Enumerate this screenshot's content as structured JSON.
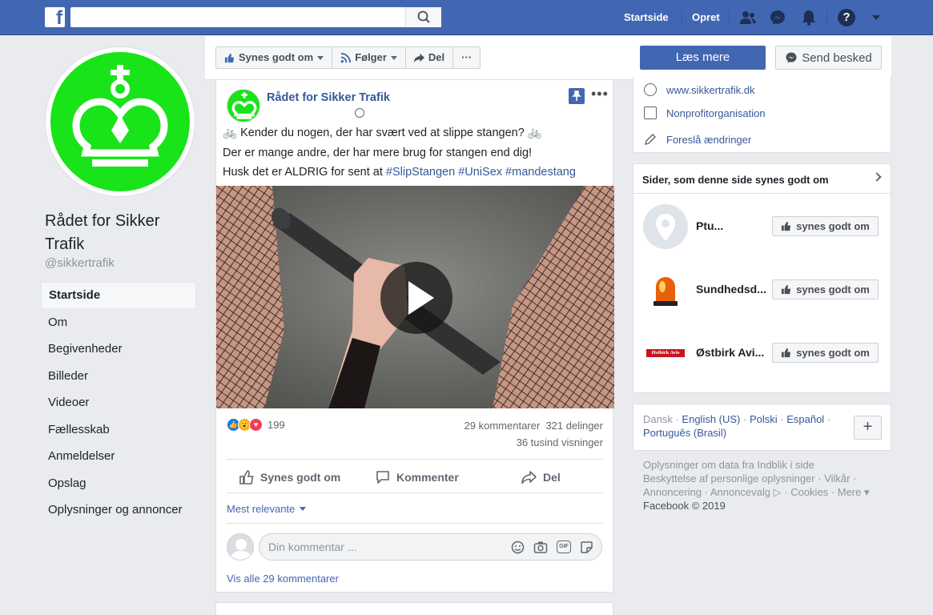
{
  "topbar": {
    "logo": "f",
    "search_value": "",
    "nav": [
      "Startside",
      "Opret"
    ],
    "icons": [
      "friends-icon",
      "messenger-icon",
      "bell-icon",
      "help-icon",
      "caret-down-icon"
    ],
    "help_glyph": "?"
  },
  "page": {
    "name": "Rådet for Sikker Trafik",
    "handle": "@sikkertrafik",
    "nav": [
      "Startside",
      "Om",
      "Begivenheder",
      "Billeder",
      "Videoer",
      "Fællesskab",
      "Anmeldelser",
      "Opslag",
      "Oplysninger og annoncer"
    ]
  },
  "actionbar": {
    "like": "Synes godt om",
    "follow": "Følger",
    "share": "Del",
    "more": "···",
    "learn_more": "Læs mere",
    "send_message": "Send besked"
  },
  "post": {
    "author": "Rådet for Sikker Trafik",
    "line1": "Kender du nogen, der har svært ved at slippe stangen?",
    "line2": "Der er mange andre, der har mere brug for stangen end dig!",
    "line3_prefix": "Husk det er ALDRIG for sent at",
    "hashtags": [
      "#SlipStangen",
      "#UniSex",
      "#mandestang"
    ],
    "reactions_count": "199",
    "comments": "29 kommentarer",
    "shares": "321 delinger",
    "views": "36 tusind visninger",
    "actions": [
      "Synes godt om",
      "Kommenter",
      "Del"
    ],
    "sort": "Mest relevante",
    "comment_placeholder": "Din kommentar ...",
    "comment_icons": [
      "emoji-icon",
      "camera-icon",
      "gif-icon",
      "sticker-icon"
    ],
    "gif_label": "GIF",
    "view_all": "Vis alle 29 kommentarer"
  },
  "info": {
    "website": "www.sikkertrafik.dk",
    "category": "Nonprofitorganisation",
    "suggest": "Foreslå ændringer"
  },
  "liked_pages": {
    "title": "Sider, som denne side synes godt om",
    "button": "synes godt om",
    "items": [
      {
        "name": "Ptu..."
      },
      {
        "name": "Sundhedsd..."
      },
      {
        "name": "Østbirk Avi...",
        "logo_text": "Østbirk Avis"
      }
    ]
  },
  "languages": {
    "current": "Dansk",
    "others": [
      "English (US)",
      "Polski",
      "Español",
      "Português (Brasil)"
    ],
    "plus": "+"
  },
  "footer": {
    "links": [
      "Oplysninger om data fra Indblik i side",
      "Beskyttelse af personlige oplysninger",
      "Vilkår",
      "Annoncering",
      "Annoncevalg",
      "Cookies",
      "Mere"
    ],
    "copyright": "Facebook © 2019"
  },
  "colors": {
    "brand_blue": "#4267b2",
    "link_blue": "#365899",
    "avatar_green": "#19e319"
  }
}
